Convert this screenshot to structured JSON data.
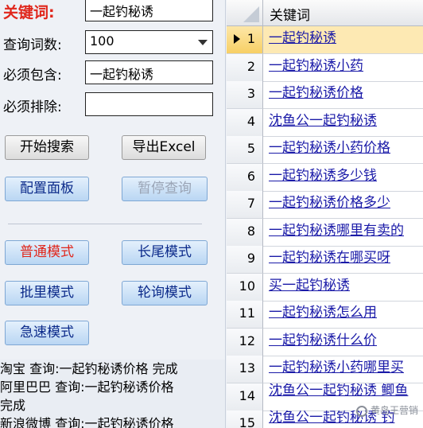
{
  "form": {
    "keyword_label": "关键词:",
    "keyword_value": "一起钓秘诱",
    "count_label": "查询词数:",
    "count_value": "100",
    "include_label": "必须包含:",
    "include_value": "一起钓秘诱",
    "exclude_label": "必须排除:",
    "exclude_value": ""
  },
  "buttons": {
    "start_search": "开始搜索",
    "export_excel": "导出Excel",
    "config_panel": "配置面板",
    "pause_query": "暂停查询",
    "normal_mode": "普通模式",
    "longtail_mode": "长尾模式",
    "batch_mode": "批里模式",
    "poll_mode": "轮询模式",
    "fast_mode": "急速模式"
  },
  "log": [
    "淘宝 查询:一起钓秘诱价格 完成",
    "阿里巴巴 查询:一起钓秘诱价格",
    "完成",
    "新浪微博 查询:一起钓秘诱价格"
  ],
  "grid": {
    "column_header": "关键词",
    "rows": [
      {
        "num": "1",
        "text": "一起钓秘诱"
      },
      {
        "num": "2",
        "text": "一起钓秘诱小药"
      },
      {
        "num": "3",
        "text": "一起钓秘诱价格"
      },
      {
        "num": "4",
        "text": "沈鱼公一起钓秘诱"
      },
      {
        "num": "5",
        "text": "一起钓秘诱小药价格"
      },
      {
        "num": "6",
        "text": "一起钓秘诱多少钱"
      },
      {
        "num": "7",
        "text": "一起钓秘诱价格多少"
      },
      {
        "num": "8",
        "text": "一起钓秘诱哪里有卖的"
      },
      {
        "num": "9",
        "text": "一起钓秘诱在哪买呀"
      },
      {
        "num": "10",
        "text": "买一起钓秘诱"
      },
      {
        "num": "11",
        "text": "一起钓秘诱怎么用"
      },
      {
        "num": "12",
        "text": "一起钓秘诱什么价"
      },
      {
        "num": "13",
        "text": "一起钓秘诱小药哪里买"
      },
      {
        "num": "14",
        "text": "沈鱼公一起钓秘诱 鲫鱼"
      },
      {
        "num": "15",
        "text": "沈鱼公一起钓秘诱 钓"
      }
    ],
    "selected_row": "1"
  },
  "watermark": "黄岛王营销",
  "colors": {
    "label_red": "#e0261b",
    "link_blue": "#1a1aa8",
    "selected_row": "#fde9b3",
    "button_blue": "#b9d6f3"
  }
}
